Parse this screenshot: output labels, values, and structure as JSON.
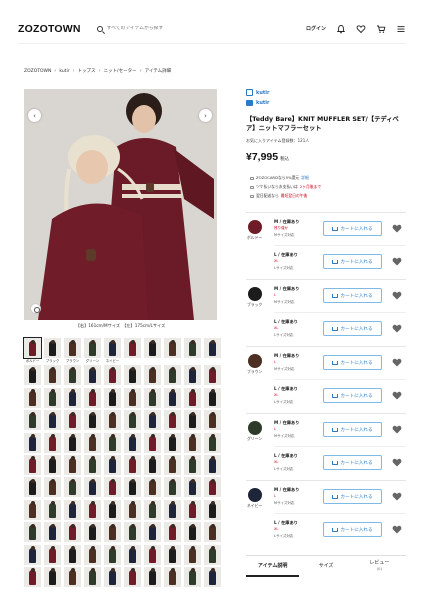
{
  "header": {
    "logo": "ZOZOTOWN",
    "search_placeholder": "すべてのアイテムから探す",
    "login": "ログイン",
    "icons": [
      "bell-icon",
      "heart-icon",
      "cart-icon",
      "menu-icon"
    ]
  },
  "breadcrumb": [
    "ZOZOTOWN",
    "kutir",
    "トップス",
    "ニット/セーター",
    "アイテム詳細"
  ],
  "gallery": {
    "caption": "【右】161cm/Mサイズ　【左】175cm/Lサイズ",
    "first_row_labels": [
      "ボルドー",
      "ブラック",
      "ブラウン",
      "グリーン",
      "ネイビー"
    ]
  },
  "product": {
    "brand": "kutir",
    "shop": "kutir",
    "title": "【Teddy Bare】KNIT MUFFLER SET/【テディベア】ニットマフラーセット",
    "favorites": "お気に入りアイテム登録数：121人",
    "price": "¥7,995",
    "price_note": "税込",
    "promos": [
      {
        "text_a": "ZOZOCARDなら5%還元",
        "text_b": "詳細"
      },
      {
        "text_a": "ツケ払いならお支払いは",
        "text_b": "2ヶ月後まで"
      },
      {
        "text_a": "翌日配送なら",
        "text_b": "最短翌日の午後"
      }
    ]
  },
  "colors": [
    {
      "name": "ボルドー",
      "swatch": "#6e1d28",
      "sizes": [
        {
          "size": "M / 在庫あり",
          "stock": "残り僅か",
          "detail": "Mサイズ対応"
        },
        {
          "size": "L / 在庫あり",
          "stock": "XL",
          "detail": "Lサイズ対応"
        }
      ]
    },
    {
      "name": "ブラック",
      "swatch": "#1c1c1c",
      "sizes": [
        {
          "size": "M / 在庫あり",
          "stock": "L",
          "detail": "Mサイズ対応"
        },
        {
          "size": "L / 在庫あり",
          "stock": "XL",
          "detail": "Lサイズ対応"
        }
      ]
    },
    {
      "name": "ブラウン",
      "swatch": "#4a2f22",
      "sizes": [
        {
          "size": "M / 在庫あり",
          "stock": "L",
          "detail": "Mサイズ対応"
        },
        {
          "size": "L / 在庫あり",
          "stock": "XL",
          "detail": "Lサイズ対応"
        }
      ]
    },
    {
      "name": "グリーン",
      "swatch": "#2f3b2a",
      "sizes": [
        {
          "size": "M / 在庫あり",
          "stock": "L",
          "detail": "Mサイズ対応"
        },
        {
          "size": "L / 在庫あり",
          "stock": "XL",
          "detail": "Lサイズ対応"
        }
      ]
    },
    {
      "name": "ネイビー",
      "swatch": "#1f2538",
      "sizes": [
        {
          "size": "M / 在庫あり",
          "stock": "L",
          "detail": "Mサイズ対応"
        },
        {
          "size": "L / 在庫あり",
          "stock": "XL",
          "detail": "Lサイズ対応"
        }
      ]
    }
  ],
  "cart_label": "カートに入れる",
  "tabs": [
    {
      "label": "アイテム説明",
      "count": ""
    },
    {
      "label": "サイズ",
      "count": ""
    },
    {
      "label": "レビュー",
      "count": "(0)"
    }
  ],
  "theme": {
    "accent": "#2a7bc5",
    "sale": "#d0021b",
    "bordeaux": "#6e1d28"
  }
}
